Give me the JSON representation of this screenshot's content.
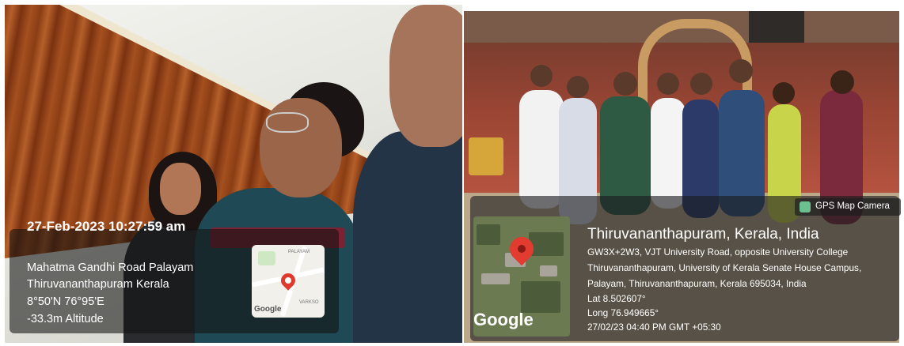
{
  "left_photo": {
    "datetime": "27-Feb-2023 10:27:59 am",
    "address_line1": "Mahatma Gandhi Road Palayam",
    "address_line2": "Thiruvananthapuram Kerala",
    "coords": "8°50'N 76°95'E",
    "altitude": "-33.3m Altitude",
    "map_logo": "Google"
  },
  "right_photo": {
    "badge": "GPS Map Camera",
    "location_title": "Thiruvananthapuram, Kerala, India",
    "address_line1": "GW3X+2W3, VJT University Road, opposite University College",
    "address_line2": "Thiruvananthapuram, University of Kerala Senate House Campus,",
    "address_line3": "Palayam, Thiruvananthapuram, Kerala 695034, India",
    "lat": "Lat 8.502607°",
    "long": "Long 76.949665°",
    "timestamp": "27/02/23 04:40 PM GMT +05:30",
    "map_logo": "Google"
  },
  "colors": {
    "pin": "#e03a2f",
    "overlay": "#1c1c1e",
    "wood": "#a4501f"
  }
}
